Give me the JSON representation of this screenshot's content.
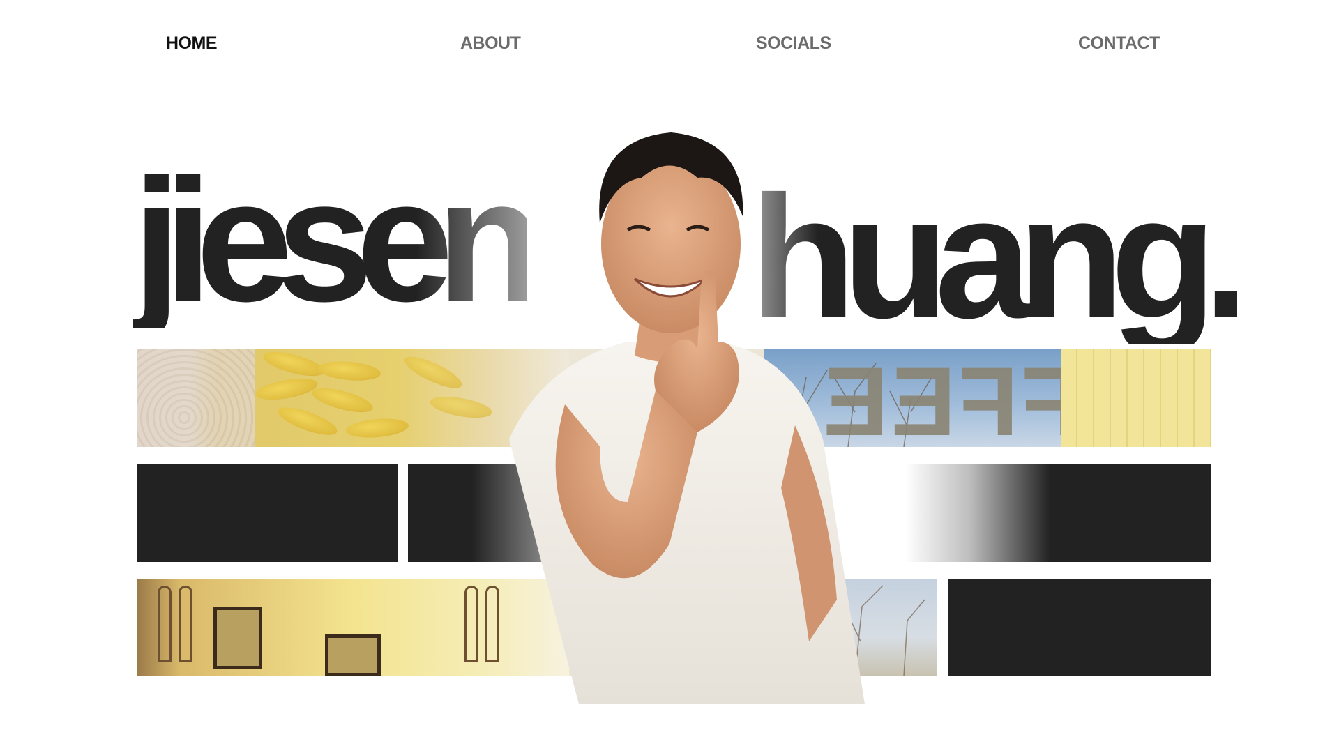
{
  "nav": {
    "home": "HOME",
    "about": "ABOUT",
    "socials": "SOCIALS",
    "contact": "CONTACT"
  },
  "hero": {
    "first_name": "jiesen",
    "last_name": "huang."
  },
  "colors": {
    "ink": "#232223",
    "nav_active": "#111111",
    "nav_inactive": "#6b6b6b",
    "background": "#ffffff"
  },
  "icons": {
    "portrait": "person-photo",
    "bananas": "photo-bananas",
    "sign": "photo-mirrored-coffee-sign",
    "shelf": "photo-shelf-with-frames"
  }
}
